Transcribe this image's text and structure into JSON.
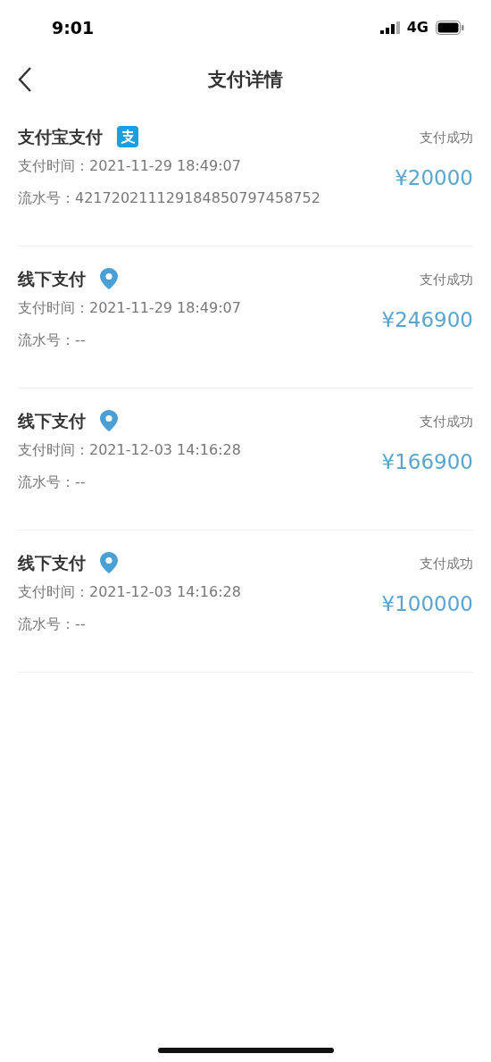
{
  "status_bar": {
    "time": "9:01",
    "network": "4G"
  },
  "header": {
    "title": "支付详情"
  },
  "payments": [
    {
      "method": "支付宝支付",
      "kind": "alipay",
      "status": "支付成功",
      "time_label": "支付时间：",
      "time": "2021-11-29 18:49:07",
      "serial_label": "流水号：",
      "serial": "421720211129184850797458752",
      "amount": "¥20000"
    },
    {
      "method": "线下支付",
      "kind": "offline",
      "status": "支付成功",
      "time_label": "支付时间：",
      "time": "2021-11-29 18:49:07",
      "serial_label": "流水号：",
      "serial": "--",
      "amount": "¥246900"
    },
    {
      "method": "线下支付",
      "kind": "offline",
      "status": "支付成功",
      "time_label": "支付时间：",
      "time": "2021-12-03 14:16:28",
      "serial_label": "流水号：",
      "serial": "--",
      "amount": "¥166900"
    },
    {
      "method": "线下支付",
      "kind": "offline",
      "status": "支付成功",
      "time_label": "支付时间：",
      "time": "2021-12-03 14:16:28",
      "serial_label": "流水号：",
      "serial": "--",
      "amount": "¥100000"
    }
  ]
}
